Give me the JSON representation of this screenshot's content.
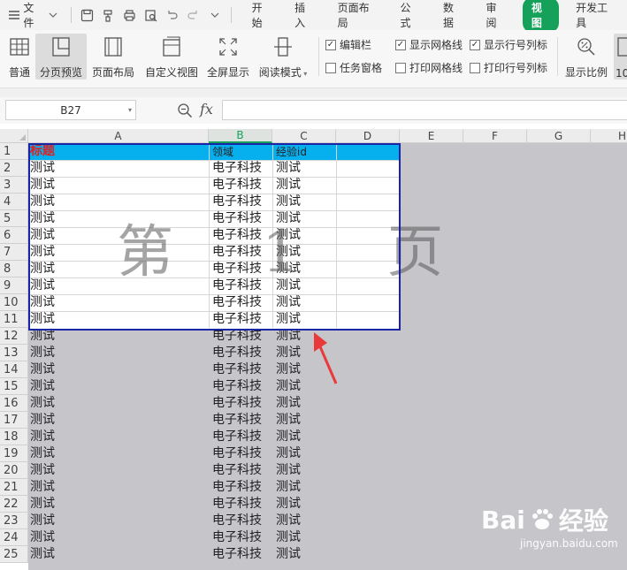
{
  "menubar": {
    "file_label": "文件",
    "tabs": [
      "开始",
      "插入",
      "页面布局",
      "公式",
      "数据",
      "审阅",
      "视图",
      "开发工具"
    ],
    "active_tab": "视图"
  },
  "ribbon": {
    "buttons": {
      "normal": "普通",
      "page_break_preview": "分页预览",
      "page_layout": "页面布局",
      "custom_view": "自定义视图",
      "fullscreen": "全屏显示",
      "reading_mode": "阅读模式",
      "zoom": "显示比例",
      "zoom_100": "10"
    },
    "checks": {
      "edit_bar": {
        "label": "编辑栏",
        "checked": true
      },
      "task_pane": {
        "label": "任务窗格",
        "checked": false
      },
      "show_gridlines": {
        "label": "显示网格线",
        "checked": true
      },
      "print_gridlines": {
        "label": "打印网格线",
        "checked": false
      },
      "show_headings": {
        "label": "显示行号列标",
        "checked": true
      },
      "print_headings": {
        "label": "打印行号列标",
        "checked": false
      }
    }
  },
  "formula_bar": {
    "cell_ref": "B27",
    "fx": "fx",
    "value": ""
  },
  "grid": {
    "columns": [
      "A",
      "B",
      "C",
      "D",
      "E",
      "F",
      "G",
      "H"
    ],
    "selected_column": "B",
    "rows": [
      "1",
      "2",
      "3",
      "4",
      "5",
      "6",
      "7",
      "8",
      "9",
      "10",
      "11",
      "12",
      "13",
      "14",
      "15",
      "16",
      "17",
      "18",
      "19",
      "20",
      "21",
      "22",
      "23",
      "24",
      "25"
    ],
    "header": {
      "a": "标题",
      "b": "领域",
      "c": "经验id"
    },
    "body": {
      "a": "测试",
      "b": "电子科技",
      "c": "测试"
    },
    "body_row_count": 24,
    "print_area_rows": 11,
    "watermark": "第 1 页"
  },
  "overlay": {
    "logo_text": "Bai",
    "logo_suffix": "经验",
    "logo_url": "jingyan.baidu.com"
  },
  "colors": {
    "accent": "#15a15a",
    "header_fill": "#06b0ee",
    "title_red": "#e02020",
    "print_border": "#1a24a6",
    "non_print": "#c6c5ca",
    "arrow": "#e83a3a"
  }
}
